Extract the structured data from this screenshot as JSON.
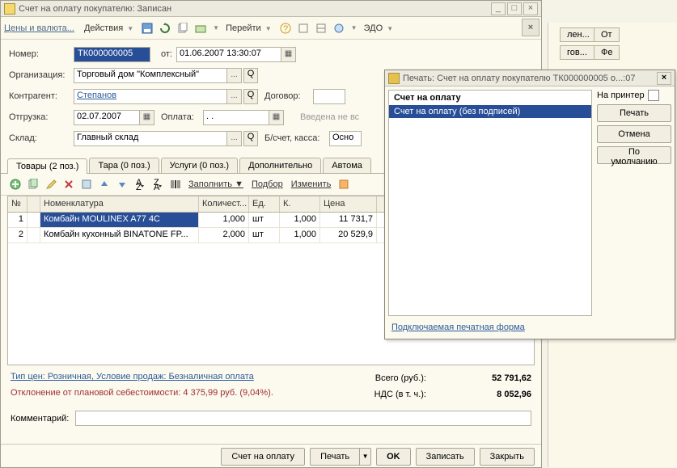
{
  "window": {
    "title": "Счет на оплату покупателю: Записан",
    "minimize": "_",
    "maximize": "□",
    "close": "×"
  },
  "toolbar": {
    "prices": "Цены и валюта...",
    "actions": "Действия",
    "goto": "Перейти",
    "edo": "ЭДО"
  },
  "form": {
    "number_label": "Номер:",
    "number_value": "ТК000000005",
    "from_label": "от:",
    "from_value": "01.06.2007 13:30:07",
    "org_label": "Организация:",
    "org_value": "Торговый дом \"Комплексный\"",
    "contr_label": "Контрагент:",
    "contr_value": "Степанов",
    "dogovor_label": "Договор:",
    "ship_label": "Отгрузка:",
    "ship_value": "02.07.2007",
    "pay_label": "Оплата:",
    "pay_value": "  .  .    ",
    "not_entered": "Введена не вс",
    "sklad_label": "Склад:",
    "sklad_value": "Главный склад",
    "bank_label": "Б/счет, касса:",
    "bank_value": "Осно"
  },
  "tabs": {
    "goods": "Товары (2 поз.)",
    "tara": "Тара (0 поз.)",
    "uslugi": "Услуги (0 поз.)",
    "extra": "Дополнительно",
    "auto": "Автома"
  },
  "grid_toolbar": {
    "fill": "Заполнить",
    "select": "Подбор",
    "change": "Изменить"
  },
  "grid": {
    "headers": [
      "№",
      "",
      "Номенклатура",
      "Количест...",
      "Ед.",
      "К.",
      "Цена"
    ],
    "rows": [
      {
        "n": "1",
        "item": "Комбайн MOULINEX  A77 4C",
        "qty": "1,000",
        "unit": "шт",
        "k": "1,000",
        "price": "11 731,7"
      },
      {
        "n": "2",
        "item": "Комбайн кухонный BINATONE FP...",
        "qty": "2,000",
        "unit": "шт",
        "k": "1,000",
        "price": "20 529,9"
      }
    ]
  },
  "footer": {
    "price_type": "Тип цен: Розничная, Условие продаж: Безналичная оплата",
    "deviation": "Отклонение от плановой себестоимости: 4 375,99 руб. (9,04%).",
    "total_label": "Всего (руб.):",
    "total_value": "52 791,62",
    "vat_label": "НДС (в т. ч.):",
    "vat_value": "8 052,96",
    "comment_label": "Комментарий:"
  },
  "buttons": {
    "invoice": "Счет на оплату",
    "print": "Печать",
    "ok": "OK",
    "save": "Записать",
    "close": "Закрыть"
  },
  "dlg": {
    "title": "Печать: Счет на оплату покупателю ТК000000005 о...:07",
    "header": "Счет на оплату",
    "item_sel": "Счет на оплату (без подписей)",
    "to_printer": "На принтер",
    "btn_print": "Печать",
    "btn_cancel": "Отмена",
    "btn_default": "По умолчанию",
    "foot": "Подключаемая печатная форма"
  },
  "bg": {
    "t1": "лен...",
    "t2": "От",
    "t3": "гов...",
    "t4": "Фе"
  }
}
